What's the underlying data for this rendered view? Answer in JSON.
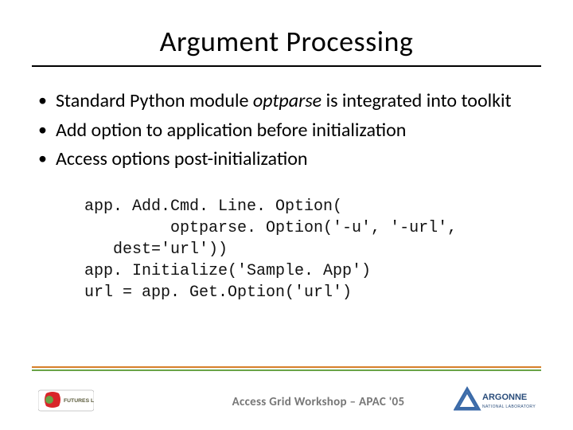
{
  "title": "Argument Processing",
  "bullets": [
    {
      "pre": "Standard Python module ",
      "em": "optparse",
      "post": " is integrated into toolkit"
    },
    {
      "pre": "Add option to application before initialization",
      "em": "",
      "post": ""
    },
    {
      "pre": "Access options post-initialization",
      "em": "",
      "post": ""
    }
  ],
  "code": "app. Add.Cmd. Line. Option(\n         optparse. Option('-u', '-url',\n   dest='url'))\napp. Initialize('Sample. App')\nurl = app. Get.Option('url')",
  "footer": "Access Grid Workshop – APAC '05",
  "logos": {
    "left_alt": "Futures Lab logo",
    "right_alt": "Argonne National Laboratory logo",
    "right_text_top": "ARGONNE",
    "right_text_bottom": "NATIONAL LABORATORY"
  },
  "colors": {
    "rule_orange": "#d67f29",
    "rule_green": "#6aa447"
  }
}
